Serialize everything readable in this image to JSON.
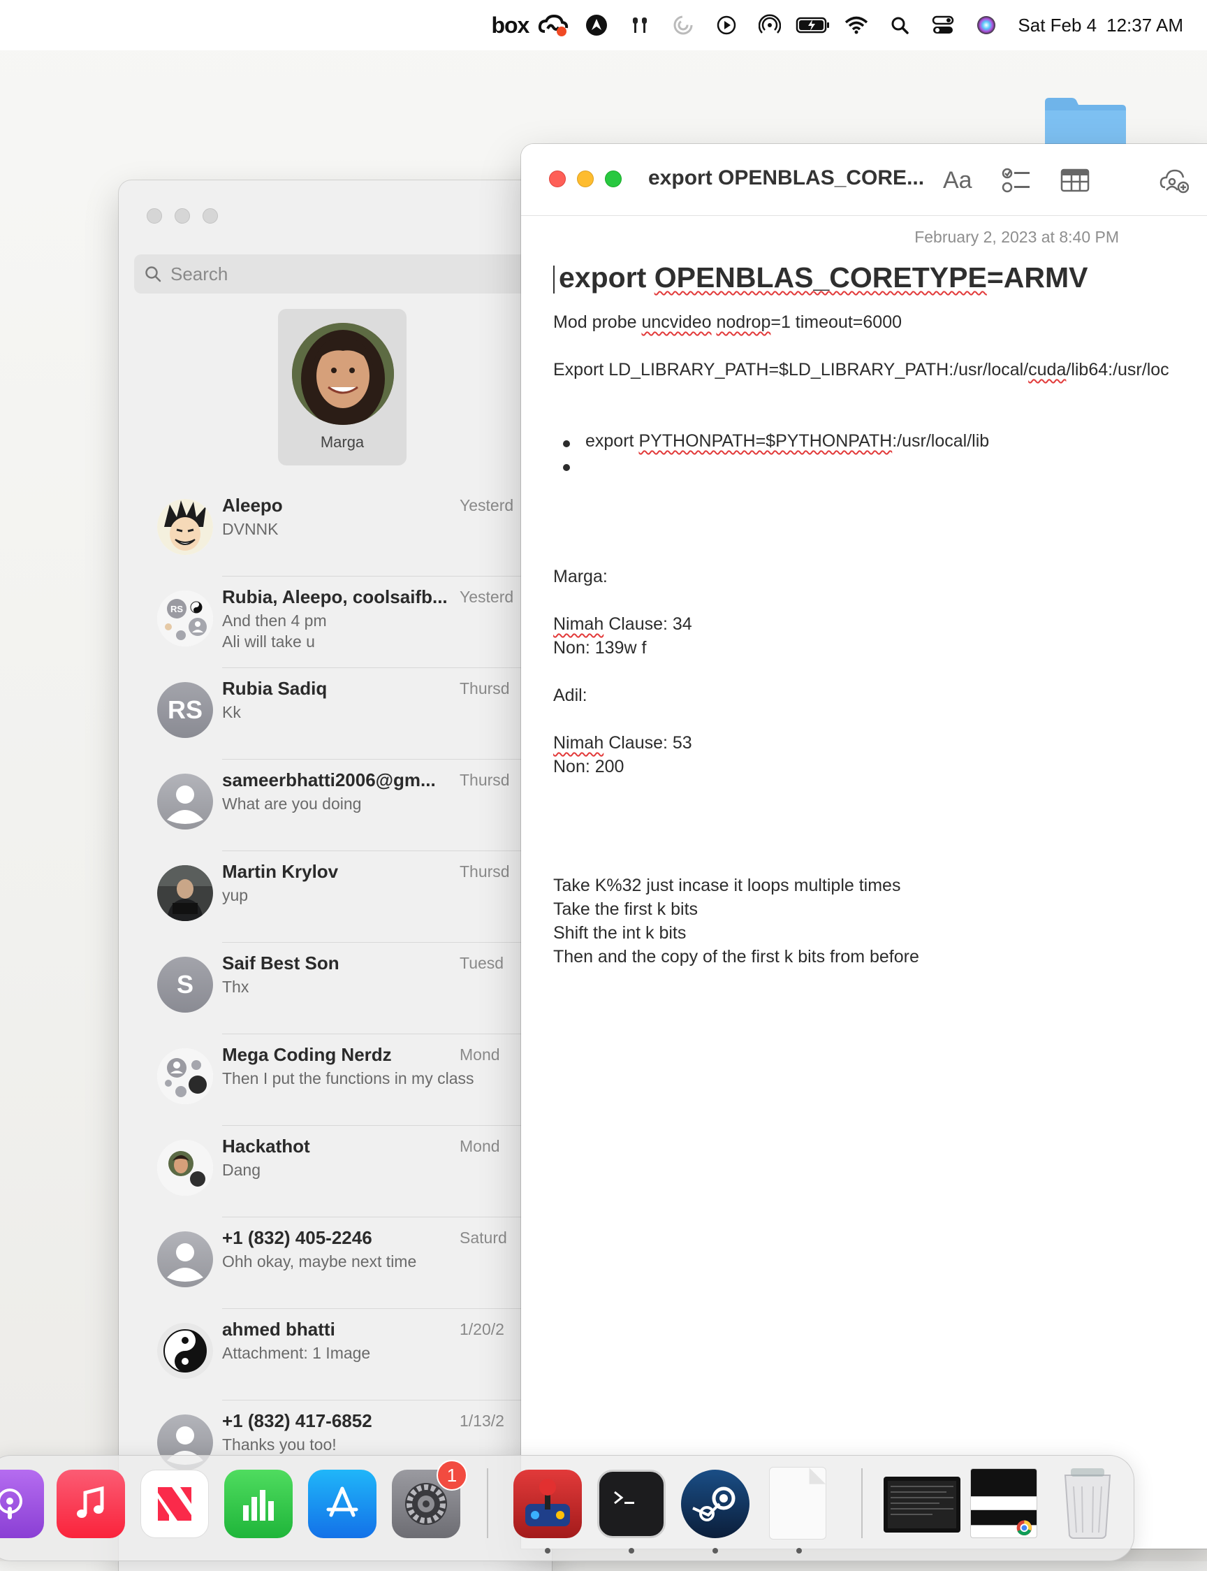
{
  "menubar": {
    "icons": [
      "box-icon",
      "creative-cloud-icon",
      "cursor-app-icon",
      "airpods-icon",
      "loading-icon",
      "play-icon",
      "airdrop-icon",
      "battery-icon",
      "wifi-icon",
      "search-icon",
      "control-center-icon",
      "siri-icon"
    ],
    "box_label": "box",
    "date": "Sat Feb 4",
    "time": "12:37 AM"
  },
  "messages": {
    "search_placeholder": "Search",
    "pinned": {
      "name": "Marga"
    },
    "conversations": [
      {
        "name": "Aleepo",
        "date": "Yesterd",
        "preview": "DVNNK",
        "avatar": "anime"
      },
      {
        "name": "Rubia, Aleepo, coolsaifb...",
        "date": "Yesterd",
        "preview": "And then 4 pm\nAli will take u",
        "avatar": "group",
        "group_initials": "RS"
      },
      {
        "name": "Rubia Sadiq",
        "date": "Thursd",
        "preview": "Kk",
        "avatar": "initials",
        "initials": "RS"
      },
      {
        "name": "sameerbhatti2006@gm...",
        "date": "Thursd",
        "preview": "What are you doing",
        "avatar": "person"
      },
      {
        "name": "Martin Krylov",
        "date": "Thursd",
        "preview": "yup",
        "avatar": "photo"
      },
      {
        "name": "Saif Best Son",
        "date": "Tuesd",
        "preview": "Thx",
        "avatar": "initials",
        "initials": "S"
      },
      {
        "name": "Mega Coding Nerdz",
        "date": "Mond",
        "preview": "Then I put the functions in my class",
        "avatar": "group"
      },
      {
        "name": "Hackathot",
        "date": "Mond",
        "preview": "Dang",
        "avatar": "group-photo"
      },
      {
        "name": "+1 (832) 405-2246",
        "date": "Saturd",
        "preview": "Ohh okay, maybe next time",
        "avatar": "person"
      },
      {
        "name": "ahmed bhatti",
        "date": "1/20/2",
        "preview": "Attachment: 1 Image",
        "avatar": "yinyang"
      },
      {
        "name": "+1 (832) 417-6852",
        "date": "1/13/2",
        "preview": "Thanks you too!",
        "avatar": "person"
      }
    ]
  },
  "notes": {
    "window_title": "export OPENBLAS_CORE...",
    "toolbar_aa": "Aa",
    "date": "February 2, 2023 at 8:40 PM",
    "heading": "export OPENBLAS_CORETYPE=ARMV",
    "line1": "Mod probe uncvideo nodrop=1 timeout=6000",
    "line2": "Export LD_LIBRARY_PATH=$LD_LIBRARY_PATH:/usr/local/cuda/lib64:/usr/loc",
    "bullet1": "export PYTHONPATH=$PYTHONPATH:/usr/local/lib",
    "marga": "Marga:",
    "marga_clause": "Nimah Clause: 34",
    "marga_non": "Non: 139w f",
    "adil": "Adil:",
    "adil_clause": "Nimah Clause: 53",
    "adil_non": "Non: 200",
    "algo1": "Take K%32 just incase it loops multiple times",
    "algo2": "Take the first k bits",
    "algo3": "Shift the int k bits",
    "algo4": "Then and the copy of the first k bits from before"
  },
  "dock": {
    "items": [
      "podcasts",
      "music",
      "news",
      "numbers",
      "app-store",
      "system-settings",
      "joystick-app",
      "terminal",
      "steam",
      "document",
      "screen-preview",
      "chrome-preview",
      "trash"
    ],
    "settings_badge": "1"
  }
}
